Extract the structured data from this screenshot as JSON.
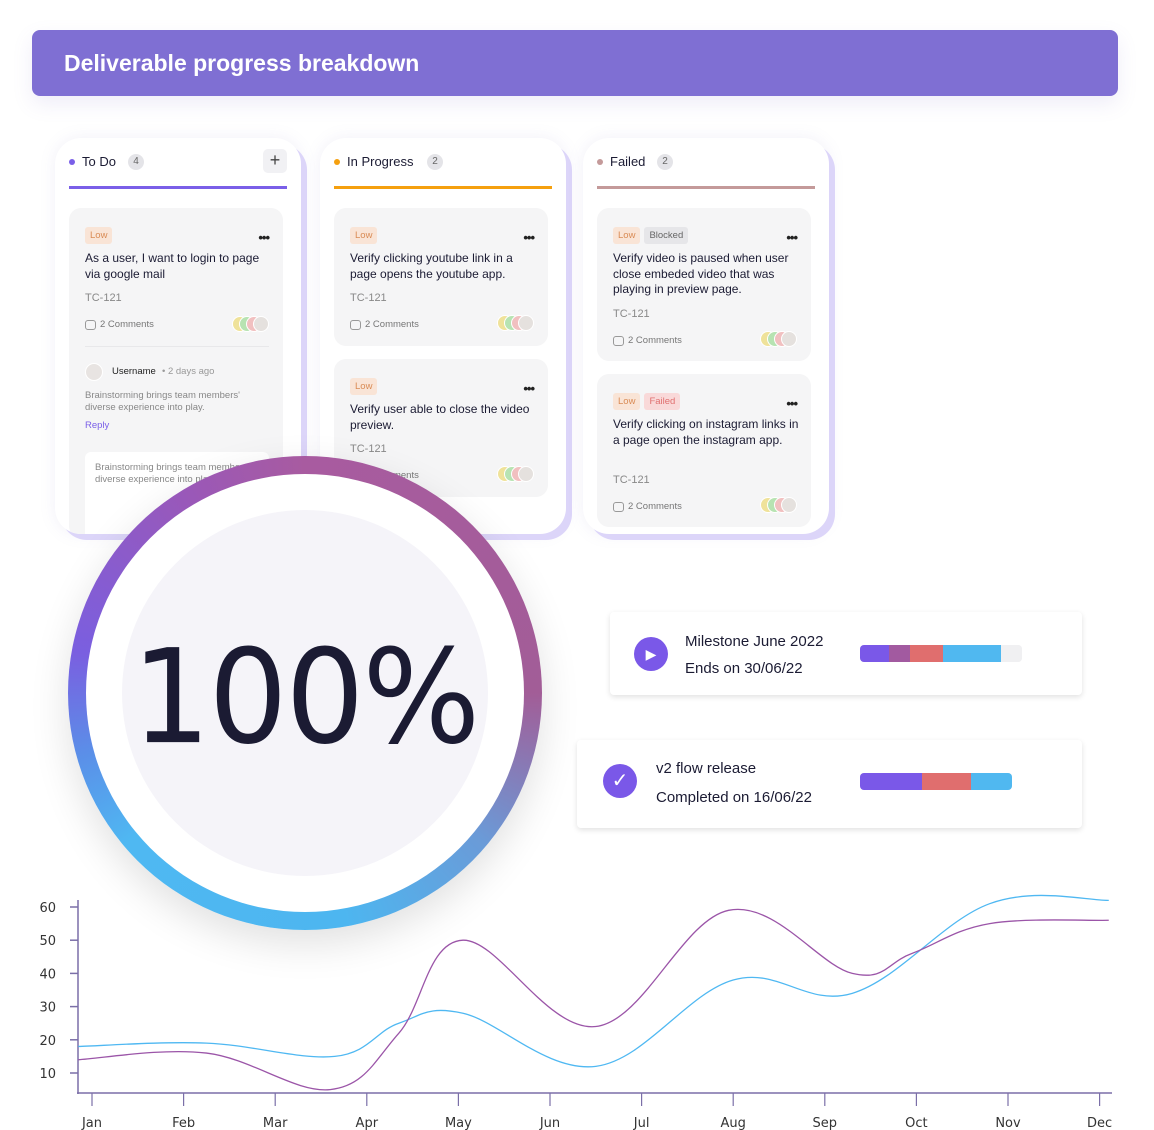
{
  "header": {
    "title": "Deliverable progress breakdown"
  },
  "board": {
    "columns": [
      {
        "title": "To Do",
        "count": "4",
        "color": "#7a5fe8",
        "add_icon": "plus-icon",
        "add_label": "+",
        "cards": [
          {
            "tags": [
              "Low"
            ],
            "title": "As a user, I want to login to page via google mail",
            "id": "TC-121",
            "comments": "2 Comments",
            "comment": {
              "user": "Username",
              "time": "• 2 days ago",
              "text": "Brainstorming brings team members' diverse experience into play.",
              "reply": "Reply"
            },
            "reply_box": "Brainstorming brings team members' diverse experience into play."
          }
        ]
      },
      {
        "title": "In Progress",
        "count": "2",
        "color": "#f5a00e",
        "cards": [
          {
            "tags": [
              "Low"
            ],
            "title": "Verify clicking youtube link in a page opens the youtube app.",
            "id": "TC-121",
            "comments": "2 Comments"
          },
          {
            "tags": [
              "Low"
            ],
            "title": "Verify user able to close the video preview.",
            "id": "TC-121",
            "comments": "2 Comments"
          }
        ]
      },
      {
        "title": "Failed",
        "count": "2",
        "color": "#c49a9a",
        "cards": [
          {
            "tags": [
              "Low",
              "Blocked"
            ],
            "title": "Verify video is paused when user close embeded video that was playing in preview page.",
            "id": "TC-121",
            "comments": "2 Comments"
          },
          {
            "tags": [
              "Low",
              "Failed"
            ],
            "title": "Verify clicking on instagram links in a page open the instagram app.",
            "id": "TC-121",
            "comments": "2 Comments"
          }
        ]
      }
    ]
  },
  "progress": {
    "value": "100%",
    "percent": 100
  },
  "milestones": [
    {
      "title": "Milestone June 2022",
      "subtitle": "Ends on 30/06/22",
      "icon": "play-icon",
      "glyph": "▶",
      "segments": [
        {
          "color": "#7a58e8",
          "fraction": 0.18
        },
        {
          "color": "#a25aa0",
          "fraction": 0.13
        },
        {
          "color": "#e06e6e",
          "fraction": 0.2
        },
        {
          "color": "#50b8f0",
          "fraction": 0.36
        },
        {
          "color": "#f0f0f2",
          "fraction": 0.13
        }
      ]
    },
    {
      "title": "v2 flow release",
      "subtitle": "Completed on 16/06/22",
      "icon": "check-icon",
      "glyph": "✓",
      "segments": [
        {
          "color": "#7a58e8",
          "fraction": 0.41
        },
        {
          "color": "#e06e6e",
          "fraction": 0.32
        },
        {
          "color": "#50b8f0",
          "fraction": 0.27
        }
      ]
    }
  ],
  "chart_data": {
    "type": "line",
    "categories": [
      "Jan",
      "Feb",
      "Mar",
      "Apr",
      "May",
      "Jun",
      "Jul",
      "Aug",
      "Sep",
      "Oct",
      "Nov",
      "Dec"
    ],
    "yticks": [
      10,
      20,
      30,
      40,
      50,
      60
    ],
    "ylim": [
      4,
      62
    ],
    "grid": false,
    "series": [
      {
        "color": "#4fb8f2",
        "points": [
          [
            -0.15,
            18
          ],
          [
            1.25,
            19
          ],
          [
            2.65,
            15
          ],
          [
            3.35,
            25
          ],
          [
            4.05,
            28
          ],
          [
            5.5,
            12
          ],
          [
            7.0,
            38
          ],
          [
            8.3,
            34
          ],
          [
            9.8,
            61
          ],
          [
            11.1,
            62
          ]
        ]
      },
      {
        "color": "#9b55a8",
        "points": [
          [
            -0.15,
            14
          ],
          [
            1.25,
            16
          ],
          [
            2.6,
            5
          ],
          [
            3.35,
            22
          ],
          [
            4.05,
            50
          ],
          [
            5.5,
            24
          ],
          [
            6.95,
            59
          ],
          [
            8.3,
            40
          ],
          [
            8.95,
            46
          ],
          [
            9.8,
            55
          ],
          [
            11.1,
            56
          ]
        ]
      }
    ]
  }
}
